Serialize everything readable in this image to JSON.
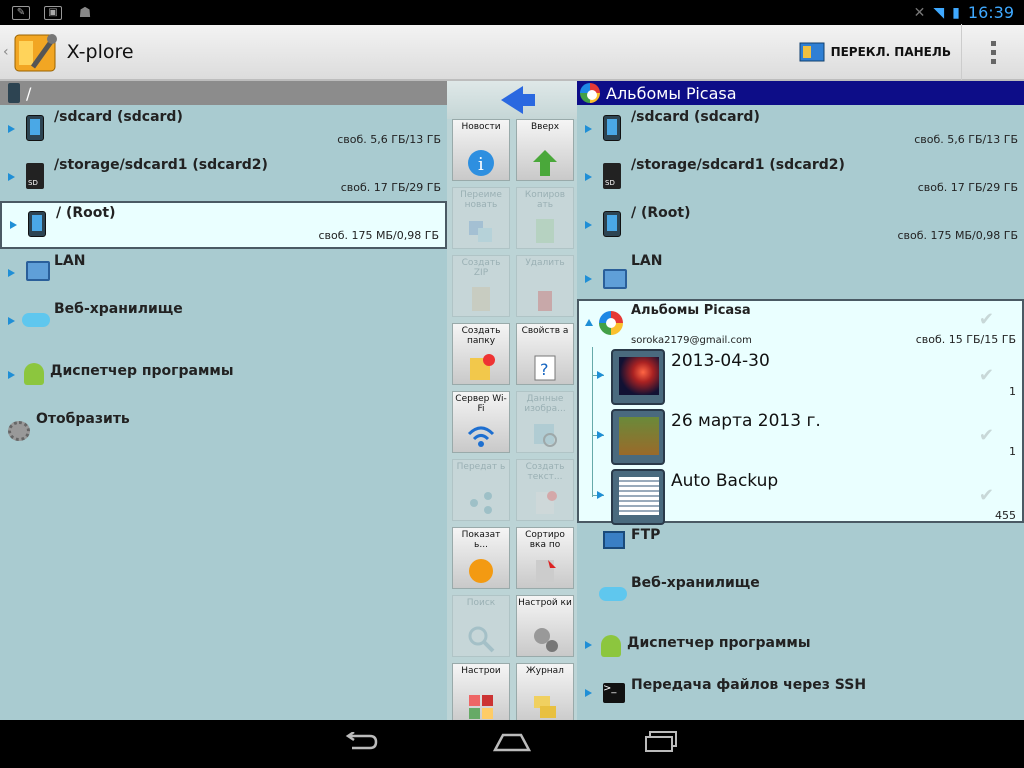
{
  "status": {
    "time": "16:39"
  },
  "actionbar": {
    "title": "X-plore",
    "switch_label": "ПЕРЕКЛ. ПАНЕЛЬ"
  },
  "left": {
    "path": "/",
    "items": [
      {
        "name": "/sdcard (sdcard)",
        "free": "своб. 5,6 ГБ/13 ГБ"
      },
      {
        "name": "/storage/sdcard1 (sdcard2)",
        "free": "своб. 17 ГБ/29 ГБ"
      },
      {
        "name": "/ (Root)",
        "free": "своб. 175 МБ/0,98 ГБ"
      },
      {
        "name": "LAN"
      },
      {
        "name": "Веб-хранилище"
      },
      {
        "name": "Диспетчер программы"
      },
      {
        "name": "Отобразить"
      }
    ]
  },
  "right": {
    "path": "Альбомы Picasa",
    "items": [
      {
        "name": "/sdcard (sdcard)",
        "free": "своб. 5,6 ГБ/13 ГБ"
      },
      {
        "name": "/storage/sdcard1 (sdcard2)",
        "free": "своб. 17 ГБ/29 ГБ"
      },
      {
        "name": "/ (Root)",
        "free": "своб. 175 МБ/0,98 ГБ"
      },
      {
        "name": "LAN"
      }
    ],
    "group": {
      "name": "Альбомы Picasa",
      "email": "soroka2179@gmail.com",
      "free": "своб. 15 ГБ/15 ГБ",
      "albums": [
        {
          "name": "2013-04-30",
          "count": "1"
        },
        {
          "name": "26 марта 2013 г.",
          "count": "1"
        },
        {
          "name": "Auto Backup",
          "count": "455"
        }
      ]
    },
    "items2": [
      {
        "name": "FTP"
      },
      {
        "name": "Веб-хранилище"
      },
      {
        "name": "Диспетчер программы"
      },
      {
        "name": "Передача файлов через SSH"
      }
    ]
  },
  "toolbar": {
    "buttons": [
      {
        "label": "Новости"
      },
      {
        "label": "Вверх"
      },
      {
        "label": "Переиме новать"
      },
      {
        "label": "Копиров ать"
      },
      {
        "label": "Создать ZIP"
      },
      {
        "label": "Удалить"
      },
      {
        "label": "Создать папку"
      },
      {
        "label": "Свойств а"
      },
      {
        "label": "Сервер Wi-Fi"
      },
      {
        "label": "Данные изобра..."
      },
      {
        "label": "Передат ь"
      },
      {
        "label": "Создать текст..."
      },
      {
        "label": "Показат ь..."
      },
      {
        "label": "Сортиро вка по"
      },
      {
        "label": "Поиск"
      },
      {
        "label": "Настрой ки"
      },
      {
        "label": "Настрои"
      },
      {
        "label": "Журнал"
      }
    ]
  }
}
